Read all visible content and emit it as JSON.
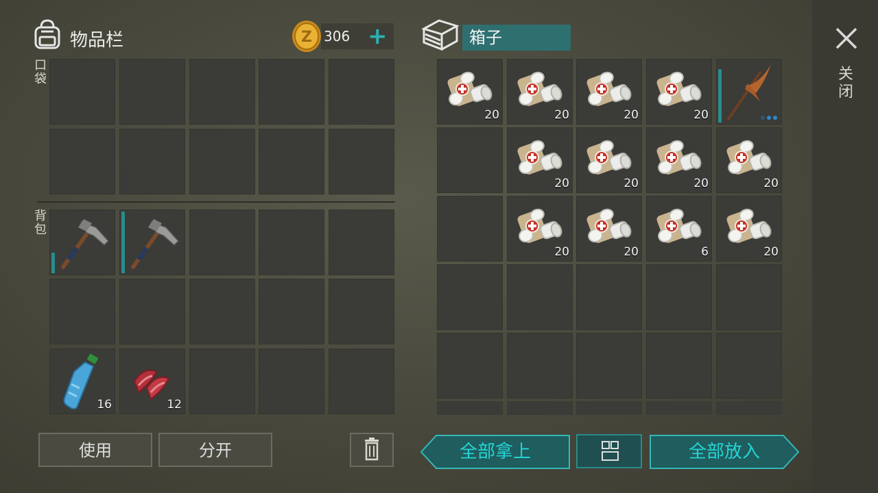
{
  "inventory": {
    "title": "物品栏",
    "coins": "306",
    "pocket_label": "口袋",
    "backpack_label": "背包",
    "use_button": "使用",
    "split_button": "分开",
    "slots": {
      "bp_water_qty": "16",
      "bp_meat_qty": "12"
    }
  },
  "chest": {
    "title": "箱子",
    "take_all_button": "全部拿上",
    "put_all_button": "全部放入",
    "quantities": {
      "r0c0": "20",
      "r0c1": "20",
      "r0c2": "20",
      "r0c3": "20",
      "r1c1": "20",
      "r1c2": "20",
      "r1c3": "20",
      "r1c4": "20",
      "r2c1": "20",
      "r2c2": "20",
      "r2c3": "6",
      "r2c4": "20"
    }
  },
  "close_label": "关闭",
  "icons": [
    "backpack-icon",
    "coin-icon",
    "plus-icon",
    "chest-icon",
    "bandage-icon",
    "pickaxe-icon",
    "hatchet-icon",
    "water-bottle-icon",
    "raw-meat-icon",
    "trash-icon",
    "sort-icon",
    "close-icon"
  ],
  "colors": {
    "accent": "#2bb0b0",
    "chest_name_bg": "#2e6f70"
  }
}
